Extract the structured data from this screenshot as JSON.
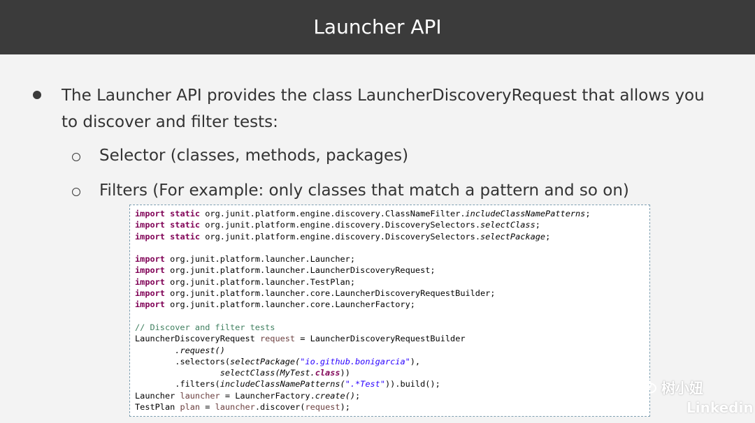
{
  "slide": {
    "title": "Launcher API",
    "bullet": {
      "text": "The Launcher API provides the class LauncherDiscoveryRequest that allows you to discover and filter tests:"
    },
    "sub_bullets": [
      "Selector (classes, methods, packages)",
      "Filters (For example: only classes that match a pattern and so on)"
    ]
  },
  "code": {
    "keyword_import": "import",
    "keyword_static": "static",
    "static_imports": [
      {
        "pkg": "org.junit.platform.engine.discovery.ClassNameFilter.",
        "member": "includeClassNamePatterns",
        "end": ";"
      },
      {
        "pkg": "org.junit.platform.engine.discovery.DiscoverySelectors.",
        "member": "selectClass",
        "end": ";"
      },
      {
        "pkg": "org.junit.platform.engine.discovery.DiscoverySelectors.",
        "member": "selectPackage",
        "end": ";"
      }
    ],
    "imports": [
      "org.junit.platform.launcher.Launcher;",
      "org.junit.platform.launcher.LauncherDiscoveryRequest;",
      "org.junit.platform.launcher.TestPlan;",
      "org.junit.platform.launcher.core.LauncherDiscoveryRequestBuilder;",
      "org.junit.platform.launcher.core.LauncherFactory;"
    ],
    "comment": "// Discover and filter tests",
    "body": {
      "l1_type": "LauncherDiscoveryRequest ",
      "l1_var": "request",
      "l1_rest": " = LauncherDiscoveryRequestBuilder",
      "l2_indent": "        ",
      "l2_method": ".request()",
      "l3_indent": "        ",
      "l3_prefix": ".selectors(",
      "l3_call": "selectPackage(",
      "l3_str": "\"io.github.bonigarcia\"",
      "l3_end": "),",
      "l4_indent": "                 ",
      "l4_call": "selectClass(MyTest.",
      "l4_kw": "class",
      "l4_end": "))",
      "l5_indent": "        ",
      "l5_prefix": ".filters(",
      "l5_call": "includeClassNamePatterns(",
      "l5_str": "\".*Test\"",
      "l5_end": ")).build();",
      "l6_type": "Launcher ",
      "l6_var": "launcher",
      "l6_mid": " = LauncherFactory.",
      "l6_call": "create()",
      "l6_end": ";",
      "l7_type": "TestPlan ",
      "l7_var": "plan",
      "l7_mid": " = ",
      "l7_var2": "launcher",
      "l7_mid2": ".discover(",
      "l7_var3": "request",
      "l7_end": ");"
    }
  },
  "watermark": {
    "account_name": "树小妞",
    "brand": "Linkedin",
    "icon": "wechat-icon"
  },
  "colors": {
    "title_bar": "#3b3b3b",
    "background": "#f3f3f3",
    "keyword": "#7f0055",
    "string": "#2a00ff",
    "comment": "#3f7f5f",
    "local_var": "#6a3e3e"
  }
}
